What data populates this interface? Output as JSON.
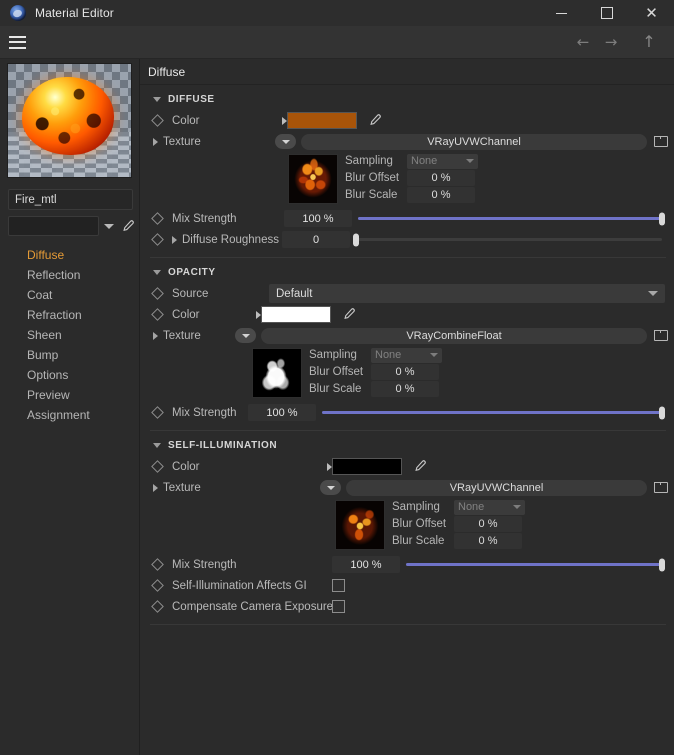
{
  "window": {
    "title": "Material Editor",
    "logo_icon": "vray-logo-icon",
    "minimize_icon": "minimize-icon",
    "maximize_icon": "maximize-icon",
    "close_icon": "close-icon"
  },
  "menubar": {
    "hamburger_icon": "hamburger-menu-icon",
    "back_icon": "arrow-left-icon",
    "forward_icon": "arrow-right-icon",
    "up_icon": "arrow-up-icon",
    "back_glyph": "←",
    "forward_glyph": "→",
    "up_glyph": "↑"
  },
  "left_panel": {
    "preview_alt": "fire-material-preview",
    "material_name": "Fire_mtl",
    "material_select_value": "",
    "eyedropper_icon": "eyedropper-icon",
    "nav_items": [
      {
        "label": "Diffuse",
        "active": true
      },
      {
        "label": "Reflection",
        "active": false
      },
      {
        "label": "Coat",
        "active": false
      },
      {
        "label": "Refraction",
        "active": false
      },
      {
        "label": "Sheen",
        "active": false
      },
      {
        "label": "Bump",
        "active": false
      },
      {
        "label": "Options",
        "active": false
      },
      {
        "label": "Preview",
        "active": false
      },
      {
        "label": "Assignment",
        "active": false
      }
    ]
  },
  "breadcrumb": {
    "text": "Diffuse"
  },
  "sections": {
    "diffuse": {
      "title": "DIFFUSE",
      "color_label": "Color",
      "color_value": "#a85409",
      "texture_label": "Texture",
      "texture_value": "VRayUVWChannel",
      "sampling_label": "Sampling",
      "sampling_value": "None",
      "blur_offset_label": "Blur Offset",
      "blur_offset_value": "0 %",
      "blur_scale_label": "Blur Scale",
      "blur_scale_value": "0 %",
      "mix_strength_label": "Mix Strength",
      "mix_strength_value": "100 %",
      "mix_strength_percent": 100,
      "roughness_label": "Diffuse Roughness",
      "roughness_value": "0",
      "roughness_percent": 0
    },
    "opacity": {
      "title": "OPACITY",
      "source_label": "Source",
      "source_value": "Default",
      "color_label": "Color",
      "color_value": "#ffffff",
      "texture_label": "Texture",
      "texture_value": "VRayCombineFloat",
      "sampling_label": "Sampling",
      "sampling_value": "None",
      "blur_offset_label": "Blur Offset",
      "blur_offset_value": "0 %",
      "blur_scale_label": "Blur Scale",
      "blur_scale_value": "0 %",
      "mix_strength_label": "Mix Strength",
      "mix_strength_value": "100 %",
      "mix_strength_percent": 100
    },
    "self_illumination": {
      "title": "SELF-ILLUMINATION",
      "color_label": "Color",
      "color_value": "#000000",
      "texture_label": "Texture",
      "texture_value": "VRayUVWChannel",
      "sampling_label": "Sampling",
      "sampling_value": "None",
      "blur_offset_label": "Blur Offset",
      "blur_offset_value": "0 %",
      "blur_scale_label": "Blur Scale",
      "blur_scale_value": "0 %",
      "mix_strength_label": "Mix Strength",
      "mix_strength_value": "100 %",
      "mix_strength_percent": 100,
      "affects_gi_label": "Self-Illumination Affects GI",
      "affects_gi_checked": false,
      "compensate_label": "Compensate Camera Exposure",
      "compensate_checked": false
    }
  },
  "theme": {
    "accent": "#e49a36",
    "slider_fill": "#6f73c8",
    "background": "#2b2b2b"
  }
}
